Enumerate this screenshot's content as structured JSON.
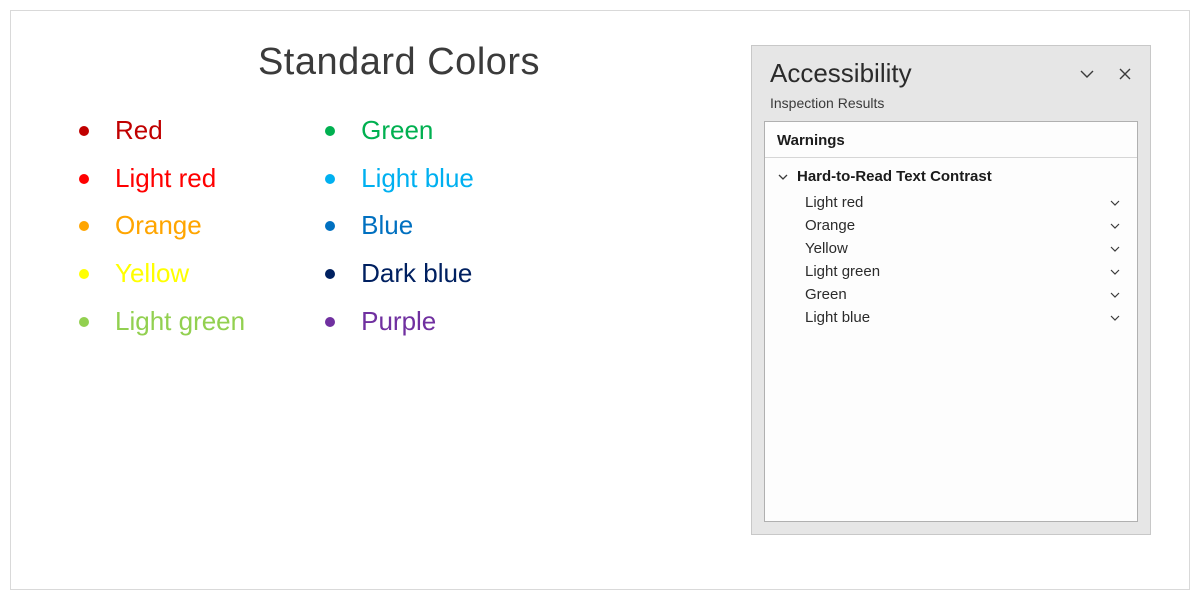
{
  "slide": {
    "title": "Standard Colors",
    "colors_left": [
      {
        "label": "Red",
        "hex": "#C00000"
      },
      {
        "label": "Light red",
        "hex": "#FF0000"
      },
      {
        "label": "Orange",
        "hex": "#FFA500"
      },
      {
        "label": "Yellow",
        "hex": "#FFFF00"
      },
      {
        "label": "Light green",
        "hex": "#92D050"
      }
    ],
    "colors_right": [
      {
        "label": "Green",
        "hex": "#00B050"
      },
      {
        "label": "Light blue",
        "hex": "#00B0F0"
      },
      {
        "label": "Blue",
        "hex": "#0070C0"
      },
      {
        "label": "Dark blue",
        "hex": "#002060"
      },
      {
        "label": "Purple",
        "hex": "#7030A0"
      }
    ]
  },
  "pane": {
    "title": "Accessibility",
    "subtitle": "Inspection Results",
    "section_header": "Warnings",
    "group_title": "Hard-to-Read Text Contrast",
    "issues": [
      "Light red",
      "Orange",
      "Yellow",
      "Light green",
      "Green",
      "Light blue"
    ]
  }
}
